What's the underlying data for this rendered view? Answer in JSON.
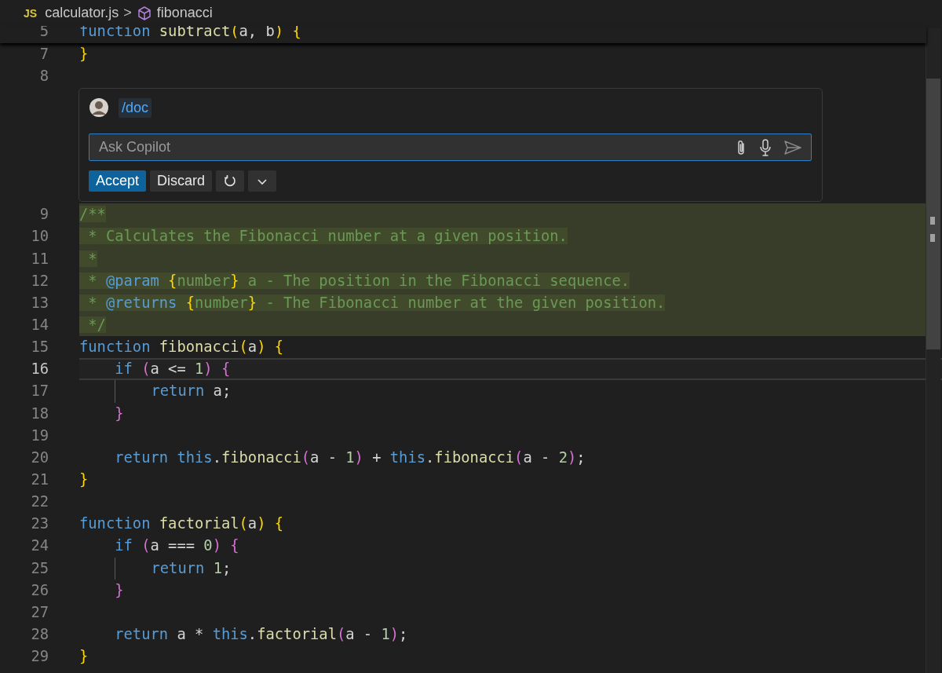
{
  "breadcrumb": {
    "file_icon": "JS",
    "file": "calculator.js",
    "separator": ">",
    "symbol": "fibonacci"
  },
  "sticky_line": {
    "number": "5",
    "tokens": [
      {
        "text": "function ",
        "kind": "keyword"
      },
      {
        "text": "subtract",
        "kind": "function"
      },
      {
        "text": "(",
        "kind": "bracket1"
      },
      {
        "text": "a, b",
        "kind": "plain"
      },
      {
        "text": ")",
        "kind": "bracket1"
      },
      {
        "text": " {",
        "kind": "bracket1"
      }
    ]
  },
  "lines_before_chat": [
    {
      "number": "7",
      "current": false,
      "inserted": false,
      "tokens": [
        {
          "text": "}",
          "kind": "bracket1"
        }
      ]
    },
    {
      "number": "8",
      "current": false,
      "inserted": false
    }
  ],
  "inline_chat": {
    "command": "/doc",
    "input": {
      "placeholder": "Ask Copilot"
    },
    "buttons": [
      {
        "kind": "primary",
        "label": "Accept"
      },
      {
        "kind": "secondary",
        "label": "Discard"
      },
      {
        "kind": "refresh"
      },
      {
        "kind": "more"
      }
    ]
  },
  "lines_after_chat": [
    {
      "number": "9",
      "current": false,
      "inserted": true,
      "tokens": [
        {
          "text": "/**",
          "kind": "comment"
        }
      ]
    },
    {
      "number": "10",
      "current": false,
      "inserted": true,
      "tokens": [
        {
          "text": " * Calculates the Fibonacci number at a given position.",
          "kind": "comment"
        }
      ]
    },
    {
      "number": "11",
      "current": false,
      "inserted": true,
      "tokens": [
        {
          "text": " *",
          "kind": "comment"
        }
      ]
    },
    {
      "number": "12",
      "current": false,
      "inserted": true,
      "tokens": [
        {
          "text": " * ",
          "kind": "comment"
        },
        {
          "text": "@param",
          "kind": "tag"
        },
        {
          "text": " {",
          "kind": "bracket1"
        },
        {
          "text": "number",
          "kind": "type"
        },
        {
          "text": "}",
          "kind": "bracket1"
        },
        {
          "text": " a - The position in the Fibonacci sequence.",
          "kind": "comment"
        }
      ]
    },
    {
      "number": "13",
      "current": false,
      "inserted": true,
      "tokens": [
        {
          "text": " * ",
          "kind": "comment"
        },
        {
          "text": "@returns",
          "kind": "tag"
        },
        {
          "text": " {",
          "kind": "bracket1"
        },
        {
          "text": "number",
          "kind": "type"
        },
        {
          "text": "}",
          "kind": "bracket1"
        },
        {
          "text": " - The Fibonacci number at the given position.",
          "kind": "comment"
        }
      ]
    },
    {
      "number": "14",
      "current": false,
      "inserted": true,
      "tokens": [
        {
          "text": " */",
          "kind": "comment"
        }
      ]
    },
    {
      "number": "15",
      "current": false,
      "inserted": false,
      "tokens": [
        {
          "text": "function ",
          "kind": "keyword"
        },
        {
          "text": "fibonacci",
          "kind": "function"
        },
        {
          "text": "(",
          "kind": "bracket1"
        },
        {
          "text": "a",
          "kind": "plain"
        },
        {
          "text": ")",
          "kind": "bracket1"
        },
        {
          "text": " {",
          "kind": "bracket1"
        }
      ]
    },
    {
      "number": "16",
      "current": true,
      "inserted": false,
      "tokens": [
        {
          "text": "    if ",
          "kind": "keyword"
        },
        {
          "text": "(",
          "kind": "bracket2"
        },
        {
          "text": "a <= ",
          "kind": "plain"
        },
        {
          "text": "1",
          "kind": "number"
        },
        {
          "text": ")",
          "kind": "bracket2"
        },
        {
          "text": " {",
          "kind": "bracket2"
        }
      ]
    },
    {
      "number": "17",
      "current": false,
      "inserted": false,
      "tokens": [
        {
          "text": "        return",
          "kind": "keyword"
        },
        {
          "text": " a;",
          "kind": "plain"
        }
      ]
    },
    {
      "number": "18",
      "current": false,
      "inserted": false,
      "tokens": [
        {
          "text": "    }",
          "kind": "bracket2"
        }
      ]
    },
    {
      "number": "19",
      "current": false,
      "inserted": false
    },
    {
      "number": "20",
      "current": false,
      "inserted": false,
      "tokens": [
        {
          "text": "    return this",
          "kind": "keyword"
        },
        {
          "text": ".",
          "kind": "plain"
        },
        {
          "text": "fibonacci",
          "kind": "function"
        },
        {
          "text": "(",
          "kind": "bracket2"
        },
        {
          "text": "a - ",
          "kind": "plain"
        },
        {
          "text": "1",
          "kind": "number"
        },
        {
          "text": ")",
          "kind": "bracket2"
        },
        {
          "text": " + ",
          "kind": "plain"
        },
        {
          "text": "this",
          "kind": "keyword"
        },
        {
          "text": ".",
          "kind": "plain"
        },
        {
          "text": "fibonacci",
          "kind": "function"
        },
        {
          "text": "(",
          "kind": "bracket2"
        },
        {
          "text": "a - ",
          "kind": "plain"
        },
        {
          "text": "2",
          "kind": "number"
        },
        {
          "text": ")",
          "kind": "bracket2"
        },
        {
          "text": ";",
          "kind": "plain"
        }
      ]
    },
    {
      "number": "21",
      "current": false,
      "inserted": false,
      "tokens": [
        {
          "text": "}",
          "kind": "bracket1"
        }
      ]
    },
    {
      "number": "22",
      "current": false,
      "inserted": false
    },
    {
      "number": "23",
      "current": false,
      "inserted": false,
      "tokens": [
        {
          "text": "function ",
          "kind": "keyword"
        },
        {
          "text": "factorial",
          "kind": "function"
        },
        {
          "text": "(",
          "kind": "bracket1"
        },
        {
          "text": "a",
          "kind": "plain"
        },
        {
          "text": ")",
          "kind": "bracket1"
        },
        {
          "text": " {",
          "kind": "bracket1"
        }
      ]
    },
    {
      "number": "24",
      "current": false,
      "inserted": false,
      "tokens": [
        {
          "text": "    if ",
          "kind": "keyword"
        },
        {
          "text": "(",
          "kind": "bracket2"
        },
        {
          "text": "a === ",
          "kind": "plain"
        },
        {
          "text": "0",
          "kind": "number"
        },
        {
          "text": ")",
          "kind": "bracket2"
        },
        {
          "text": " {",
          "kind": "bracket2"
        }
      ]
    },
    {
      "number": "25",
      "current": false,
      "inserted": false,
      "tokens": [
        {
          "text": "        return ",
          "kind": "keyword"
        },
        {
          "text": "1",
          "kind": "number"
        },
        {
          "text": ";",
          "kind": "plain"
        }
      ]
    },
    {
      "number": "26",
      "current": false,
      "inserted": false,
      "tokens": [
        {
          "text": "    }",
          "kind": "bracket2"
        }
      ]
    },
    {
      "number": "27",
      "current": false,
      "inserted": false
    },
    {
      "number": "28",
      "current": false,
      "inserted": false,
      "tokens": [
        {
          "text": "    return",
          "kind": "keyword"
        },
        {
          "text": " a * ",
          "kind": "plain"
        },
        {
          "text": "this",
          "kind": "keyword"
        },
        {
          "text": ".",
          "kind": "plain"
        },
        {
          "text": "factorial",
          "kind": "function"
        },
        {
          "text": "(",
          "kind": "bracket2"
        },
        {
          "text": "a - ",
          "kind": "plain"
        },
        {
          "text": "1",
          "kind": "number"
        },
        {
          "text": ")",
          "kind": "bracket2"
        },
        {
          "text": ";",
          "kind": "plain"
        }
      ]
    },
    {
      "number": "29",
      "current": false,
      "inserted": false,
      "tokens": [
        {
          "text": "}",
          "kind": "bracket1"
        }
      ]
    }
  ]
}
